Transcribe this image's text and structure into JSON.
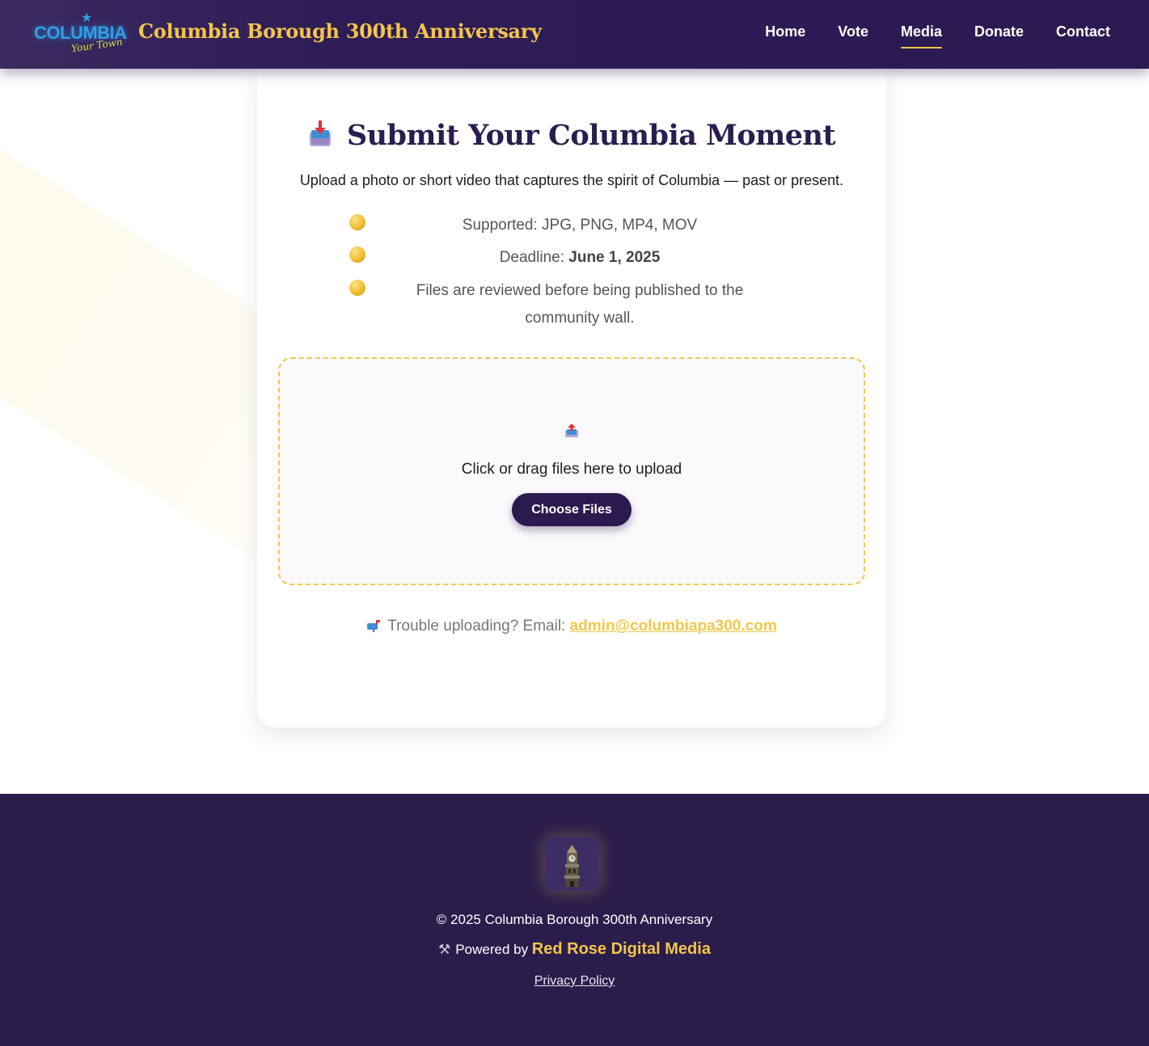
{
  "header": {
    "logo_word": "COLUMBIA",
    "logo_sub": "Your Town",
    "site_title": "Columbia Borough 300th Anniversary",
    "nav": [
      {
        "label": "Home"
      },
      {
        "label": "Vote"
      },
      {
        "label": "Media",
        "active": true
      },
      {
        "label": "Donate"
      },
      {
        "label": "Contact"
      }
    ]
  },
  "card": {
    "title": "Submit Your Columbia Moment",
    "title_icon": "inbox-upload-icon",
    "description": "Upload a photo or short video that captures the spirit of Columbia — past or present.",
    "bullets": {
      "supported": "Supported: JPG, PNG, MP4, MOV",
      "deadline_label": "Deadline: ",
      "deadline_value": "June 1, 2025",
      "review": "Files are reviewed before being published to the community wall."
    },
    "dropzone": {
      "icon": "outbox-upload-icon",
      "text": "Click or drag files here to upload",
      "button": "Choose Files"
    },
    "trouble": {
      "icon": "mailbox-icon",
      "text": "Trouble uploading? Email: ",
      "email": "admin@columbiapa300.com"
    }
  },
  "footer": {
    "emblem": "clock-tower-icon",
    "copyright": "© 2025 Columbia Borough 300th Anniversary",
    "powered_prefix": "Powered by ",
    "powered_brand": "Red Rose Digital Media",
    "privacy": "Privacy Policy"
  },
  "colors": {
    "header_bg": "#2b1a52",
    "accent_gold": "#f3c54b",
    "title_purple": "#2a1d4f",
    "footer_bg": "#2b1d4b"
  }
}
